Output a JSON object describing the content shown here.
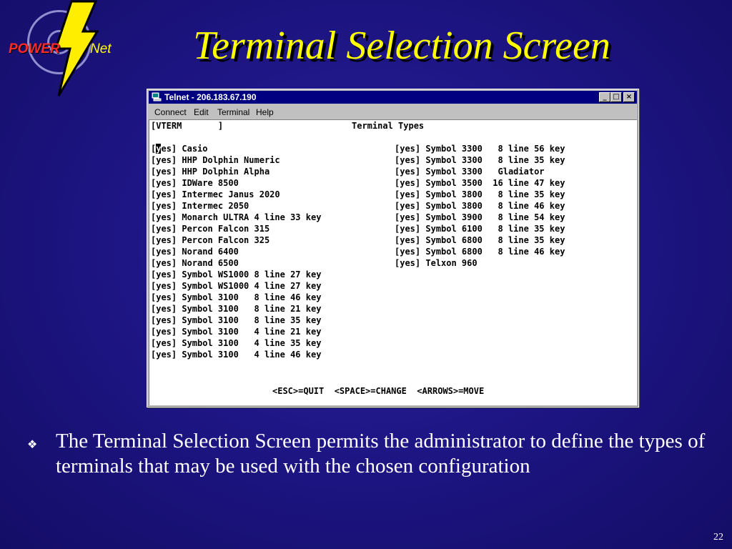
{
  "logo": {
    "word1": "POWER",
    "word2": "Net"
  },
  "slide_title": "Terminal Selection Screen",
  "window": {
    "title": "Telnet - 206.183.67.190",
    "menu": [
      "Connect",
      "Edit",
      "Terminal",
      "Help"
    ],
    "buttons": {
      "minimize": "_",
      "maximize": "□",
      "close": "×"
    }
  },
  "terminal": {
    "header_field": "[VTERM       ]",
    "header_title": "Terminal Types",
    "left_column": [
      "[yes] Casio",
      "[yes] HHP Dolphin Numeric",
      "[yes] HHP Dolphin Alpha",
      "[yes] IDWare 8500",
      "[yes] Intermec Janus 2020",
      "[yes] Intermec 2050",
      "[yes] Monarch ULTRA 4 line 33 key",
      "[yes] Percon Falcon 315",
      "[yes] Percon Falcon 325",
      "[yes] Norand 6400",
      "[yes] Norand 6500",
      "[yes] Symbol WS1000 8 line 27 key",
      "[yes] Symbol WS1000 4 line 27 key",
      "[yes] Symbol 3100   8 line 46 key",
      "[yes] Symbol 3100   8 line 21 key",
      "[yes] Symbol 3100   8 line 35 key",
      "[yes] Symbol 3100   4 line 21 key",
      "[yes] Symbol 3100   4 line 35 key",
      "[yes] Symbol 3100   4 line 46 key"
    ],
    "right_column": [
      "[yes] Symbol 3300   8 line 56 key",
      "[yes] Symbol 3300   8 line 35 key",
      "[yes] Symbol 3300   Gladiator",
      "[yes] Symbol 3500  16 line 47 key",
      "[yes] Symbol 3800   8 line 35 key",
      "[yes] Symbol 3800   8 line 46 key",
      "[yes] Symbol 3900   8 line 54 key",
      "[yes] Symbol 6100   8 line 35 key",
      "[yes] Symbol 6800   8 line 35 key",
      "[yes] Symbol 6800   8 line 46 key",
      "[yes] Telxon 960"
    ],
    "footer": "<ESC>=QUIT  <SPACE>=CHANGE  <ARROWS>=MOVE"
  },
  "bullet_text": "The Terminal Selection Screen permits the administrator to define the types of terminals that may be used with the chosen configuration",
  "page_number": "22"
}
